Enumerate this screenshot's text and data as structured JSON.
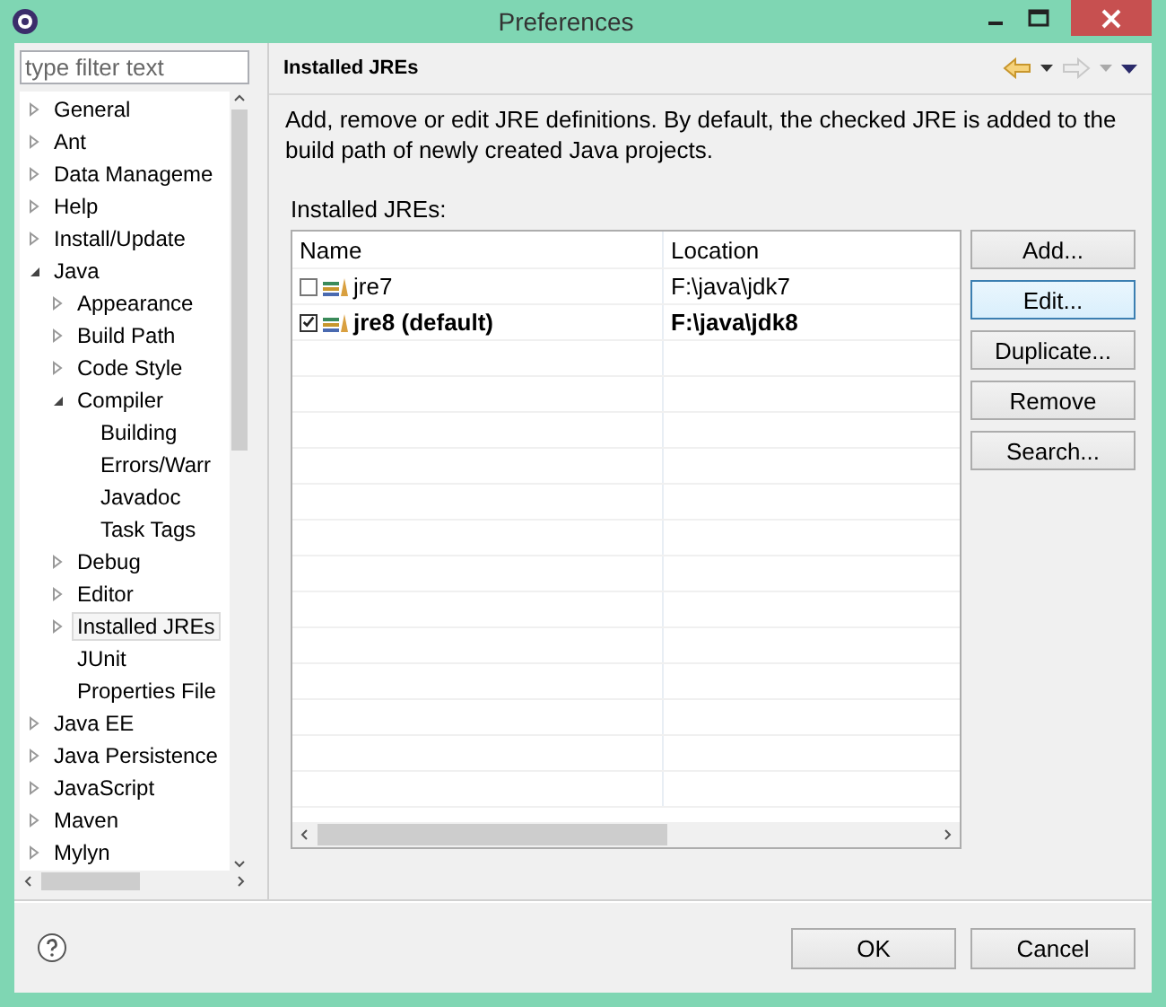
{
  "window": {
    "title": "Preferences"
  },
  "filter": {
    "placeholder": "type filter text"
  },
  "tree": [
    {
      "label": "General",
      "expanded": false,
      "selected": false
    },
    {
      "label": "Ant",
      "expanded": false,
      "selected": false
    },
    {
      "label": "Data Manageme",
      "expanded": false,
      "selected": false
    },
    {
      "label": "Help",
      "expanded": false,
      "selected": false
    },
    {
      "label": "Install/Update",
      "expanded": false,
      "selected": false
    },
    {
      "label": "Java",
      "expanded": true,
      "selected": false,
      "children": [
        {
          "label": "Appearance",
          "expanded": false,
          "selected": false
        },
        {
          "label": "Build Path",
          "expanded": false,
          "selected": false
        },
        {
          "label": "Code Style",
          "expanded": false,
          "selected": false
        },
        {
          "label": "Compiler",
          "expanded": true,
          "selected": false,
          "children": [
            {
              "label": "Building",
              "selected": false
            },
            {
              "label": "Errors/Warr",
              "selected": false
            },
            {
              "label": "Javadoc",
              "selected": false
            },
            {
              "label": "Task Tags",
              "selected": false
            }
          ]
        },
        {
          "label": "Debug",
          "expanded": false,
          "selected": false
        },
        {
          "label": "Editor",
          "expanded": false,
          "selected": false
        },
        {
          "label": "Installed JREs",
          "expanded": false,
          "selected": true
        },
        {
          "label": "JUnit",
          "selected": false
        },
        {
          "label": "Properties File",
          "selected": false
        }
      ]
    },
    {
      "label": "Java EE",
      "expanded": false,
      "selected": false
    },
    {
      "label": "Java Persistence",
      "expanded": false,
      "selected": false
    },
    {
      "label": "JavaScript",
      "expanded": false,
      "selected": false
    },
    {
      "label": "Maven",
      "expanded": false,
      "selected": false
    },
    {
      "label": "Mylyn",
      "expanded": false,
      "selected": false
    }
  ],
  "page": {
    "title": "Installed JREs",
    "description": "Add, remove or edit JRE definitions. By default, the checked JRE is added to the build path of newly created Java projects.",
    "list_label": "Installed JREs:"
  },
  "table": {
    "columns": [
      "Name",
      "Location"
    ],
    "rows": [
      {
        "name": "jre7",
        "location": "F:\\java\\jdk7",
        "checked": false
      },
      {
        "name": "jre8 (default)",
        "location": "F:\\java\\jdk8",
        "checked": true
      }
    ]
  },
  "side_buttons": [
    {
      "label": "Add...",
      "focused": false
    },
    {
      "label": "Edit...",
      "focused": true
    },
    {
      "label": "Duplicate...",
      "focused": false
    },
    {
      "label": "Remove",
      "focused": false
    },
    {
      "label": "Search...",
      "focused": false
    }
  ],
  "buttons": [
    "OK",
    "Cancel"
  ]
}
